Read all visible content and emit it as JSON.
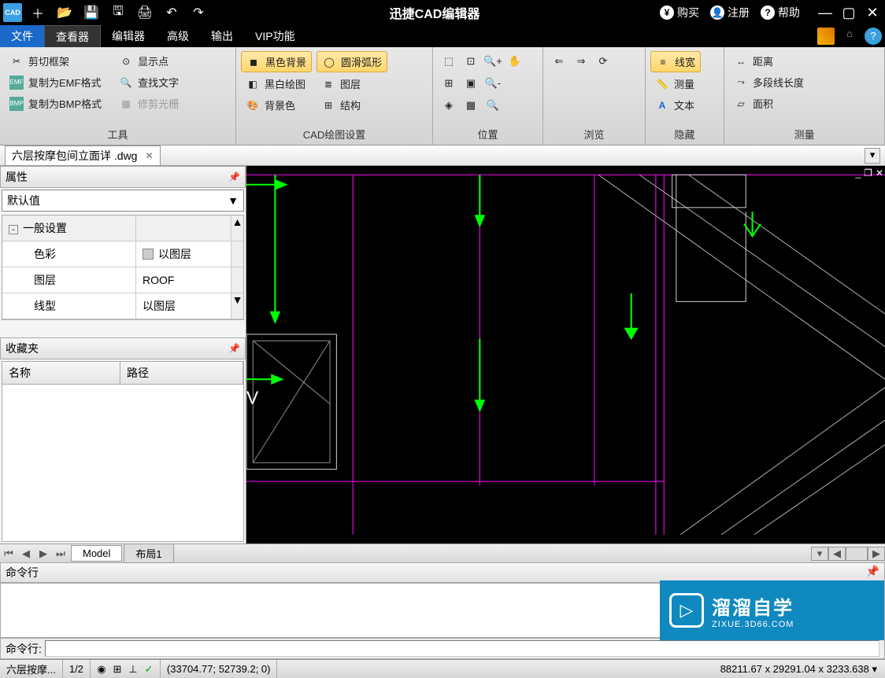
{
  "title": "迅捷CAD编辑器",
  "titlebar": {
    "logo": "CAD",
    "buy": "购买",
    "register": "注册",
    "help": "帮助"
  },
  "menu": {
    "file": "文件",
    "viewer": "查看器",
    "editor": "编辑器",
    "advanced": "高级",
    "output": "输出",
    "vip": "VIP功能"
  },
  "ribbon": {
    "tools": {
      "label": "工具",
      "cut_frame": "剪切框架",
      "copy_emf": "复制为EMF格式",
      "copy_bmp": "复制为BMP格式",
      "show_point": "显示点",
      "find_text": "查找文字",
      "trim_raster": "修剪光栅"
    },
    "cad_settings": {
      "label": "CAD绘图设置",
      "black_bg": "黑色背景",
      "bw_draw": "黑白绘图",
      "bg_color": "背景色",
      "smooth_arc": "圆滑弧形",
      "layers": "图层",
      "structure": "结构"
    },
    "position": {
      "label": "位置"
    },
    "browse": {
      "label": "浏览"
    },
    "hide": {
      "label": "隐藏",
      "line_width": "线宽",
      "measure": "测量",
      "text": "文本"
    },
    "measure": {
      "label": "测量",
      "distance": "距离",
      "polyline_len": "多段线长度",
      "area": "面积"
    }
  },
  "doc": {
    "filename": "六层按摩包间立面详 .dwg"
  },
  "props": {
    "panel_title": "属性",
    "default_val": "默认值",
    "general": "一般设置",
    "color": "色彩",
    "color_val": "以图层",
    "layer": "图层",
    "layer_val": "ROOF",
    "linetype": "线型",
    "linetype_val": "以图层"
  },
  "fav": {
    "panel_title": "收藏夹",
    "col_name": "名称",
    "col_path": "路径"
  },
  "layout": {
    "model": "Model",
    "layout1": "布局1"
  },
  "cmd": {
    "panel_title": "命令行",
    "prompt": "命令行:"
  },
  "watermark": {
    "main": "溜溜自学",
    "sub": "ZIXUE.3D66.COM"
  },
  "status": {
    "file_short": "六层按摩...",
    "page": "1/2",
    "coords": "(33704.77; 52739.2;  0)",
    "extent": "88211.67 x 29291.04 x 3233.638"
  }
}
